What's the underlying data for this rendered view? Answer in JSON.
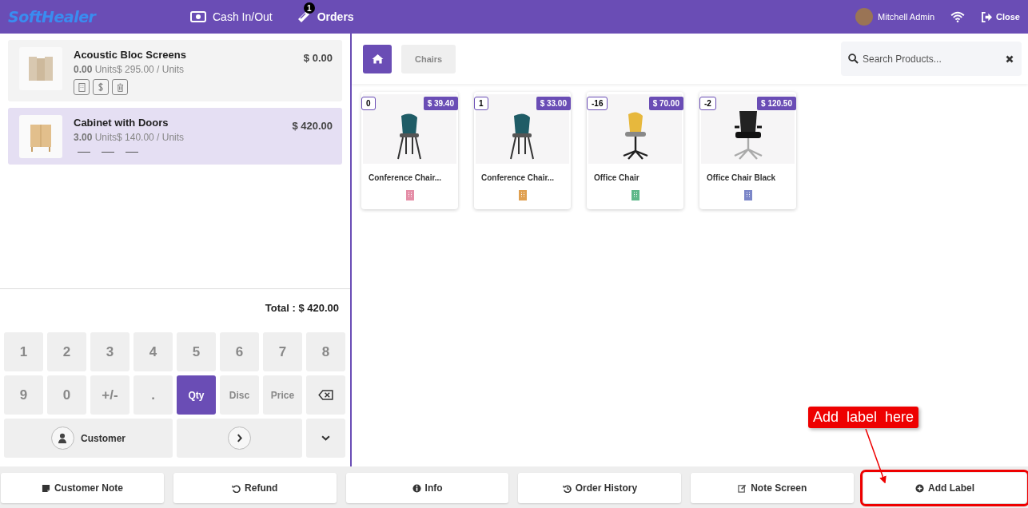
{
  "header": {
    "logo": "SoftHealer",
    "nav": [
      {
        "kind": "cash",
        "label": "Cash In/Out",
        "selected": false
      },
      {
        "kind": "orders",
        "label": "Orders",
        "badge": "1",
        "selected": true
      }
    ],
    "user": "Mitchell Admin",
    "close": "Close"
  },
  "order_lines": [
    {
      "name": "Acoustic Bloc Screens",
      "qty": "0.00",
      "unit_price": " Units$ 295.00 / Units",
      "price": "$ 0.00",
      "selected": false,
      "expanded": true,
      "kind": "screen"
    },
    {
      "name": "Cabinet with Doors",
      "qty": "3.00",
      "unit_price": " Units$ 140.00 / Units",
      "price": "$ 420.00",
      "selected": true,
      "expanded": false,
      "kind": "cabinet"
    }
  ],
  "total": "Total : $ 420.00",
  "numpad": [
    {
      "kind": "key",
      "label": "1"
    },
    {
      "kind": "key",
      "label": "2"
    },
    {
      "kind": "key",
      "label": "3"
    },
    {
      "kind": "key",
      "label": "4"
    },
    {
      "kind": "key",
      "label": "5"
    },
    {
      "kind": "key",
      "label": "6"
    },
    {
      "kind": "key",
      "label": "7"
    },
    {
      "kind": "key",
      "label": "8"
    },
    {
      "kind": "key",
      "label": "9"
    },
    {
      "kind": "key",
      "label": "0"
    },
    {
      "kind": "key",
      "label": "+/-"
    },
    {
      "kind": "key",
      "label": "."
    },
    {
      "kind": "mode",
      "label": "Qty",
      "selected": true
    },
    {
      "kind": "mode",
      "label": "Disc",
      "selected": false
    },
    {
      "kind": "mode",
      "label": "Price",
      "selected": false
    },
    {
      "kind": "backspace"
    }
  ],
  "customer_button": "Customer",
  "categories": [
    {
      "kind": "home",
      "selected": true
    },
    {
      "kind": "text",
      "label": "Chairs",
      "selected": false
    }
  ],
  "search": {
    "placeholder": "Search Products..."
  },
  "products": [
    {
      "name": "Conference Chair...",
      "stock": "0",
      "price": "$ 39.40",
      "kind": "shell",
      "color": "#e58fa8"
    },
    {
      "name": "Conference Chair...",
      "stock": "1",
      "price": "$ 33.00",
      "kind": "shell",
      "color": "#e0a050"
    },
    {
      "name": "Office Chair",
      "stock": "-16",
      "price": "$ 70.00",
      "kind": "swivel",
      "color": "#5fb88a"
    },
    {
      "name": "Office Chair Black",
      "stock": "-2",
      "price": "$ 120.50",
      "kind": "mesh",
      "color": "#7b86c8"
    }
  ],
  "action_buttons": [
    {
      "kind": "note",
      "label": "Customer Note",
      "highlighted": false
    },
    {
      "kind": "refund",
      "label": "Refund",
      "highlighted": false
    },
    {
      "kind": "info",
      "label": "Info",
      "highlighted": false
    },
    {
      "kind": "history",
      "label": "Order History",
      "highlighted": false
    },
    {
      "kind": "edit",
      "label": "Note Screen",
      "highlighted": false
    },
    {
      "kind": "plus",
      "label": "Add Label",
      "highlighted": true
    }
  ],
  "annotation": {
    "text": "Add  label  here"
  }
}
